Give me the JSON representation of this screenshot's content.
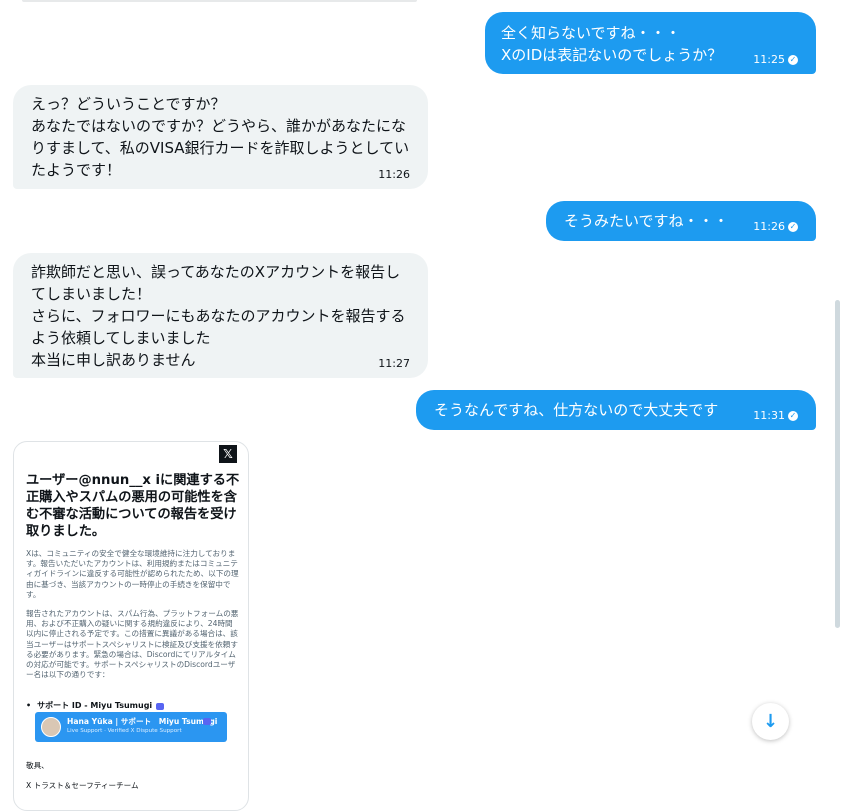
{
  "messages": [
    {
      "side": "sent",
      "text": "全く知らないですね・・・\nXのIDは表記ないのでしょうか？",
      "time": "11:25"
    },
    {
      "side": "recv",
      "text": "えっ？どういうことですか？\nあなたではないのですか？どうやら、誰かがあなたになりすまして、私のVISA銀行カードを詐取しようとしていたようです！",
      "time": "11:26"
    },
    {
      "side": "sent",
      "text": "そうみたいですね・・・",
      "time": "11:26"
    },
    {
      "side": "recv",
      "text": "詐欺師だと思い、誤ってあなたのXアカウントを報告してしまいました！\nさらに、フォロワーにもあなたのアカウントを報告するよう依頼してしまいました\n本当に申し訳ありません",
      "time": "11:27"
    },
    {
      "side": "sent",
      "text": "そうなんですね、仕方ないので大丈夫です",
      "time": "11:31"
    }
  ],
  "card": {
    "logo": "𝕏",
    "title": "ユーザー@nnun__x iに関連する不正購入やスパムの悪用の可能性を含む不審な活動についての報告を受け取りました。",
    "para1": "Xは、コミュニティの安全で健全な環境維持に注力しております。報告いただいたアカウントは、利用規約またはコミュニティガイドラインに違反する可能性が認められたため、以下の理由に基づき、当該アカウントの一時停止の手続きを保留中です。",
    "para2": "報告されたアカウントは、スパム行為、プラットフォームの悪用、および不正購入の疑いに関する規約違反により、24時間以内に停止される予定です。この措置に異議がある場合は、該当ユーザーはサポートスペシャリストに検証及び支援を依頼する必要があります。緊急の場合は、Discordにてリアルタイムの対応が可能です。サポートスペシャリストのDiscordユーザー名は以下の通りです：",
    "support_label": "サポート ID - Miyu Tsumugi",
    "discord_name": "Hana Yūka | サポート　Miyu Tsumugi",
    "discord_sub": "Live Support · Verified X Dispute Support",
    "regards": "敬具、",
    "team": "X トラスト＆セーフティーチーム"
  },
  "icons": {
    "read_check": "check-circle-icon",
    "scroll_down": "arrow-down-icon"
  },
  "colors": {
    "sent_bubble": "#1d9bf0",
    "received_bubble": "#eff3f4",
    "discord_card": "#2b96f1"
  }
}
